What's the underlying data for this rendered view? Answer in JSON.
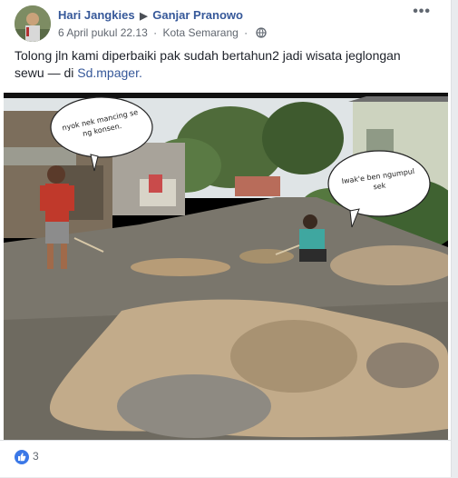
{
  "post": {
    "author": "Hari Jangkies",
    "target": "Ganjar Pranowo",
    "timestamp": "6 April pukul 22.13",
    "location": "Kota Semarang",
    "privacy_icon": "globe-icon",
    "more_icon": "•••",
    "text_main": "Tolong jln kami diperbaiki pak sudah bertahun2 jadi wisata jeglongan sewu — di ",
    "text_link": "Sd.mpager.",
    "photo": {
      "bubble_left": "nyok nek mancing se ng konsen.",
      "bubble_right": "Iwak'e ben ngumpul sek"
    },
    "reactions": {
      "icon": "thumbs-up-icon",
      "count": "3"
    }
  }
}
